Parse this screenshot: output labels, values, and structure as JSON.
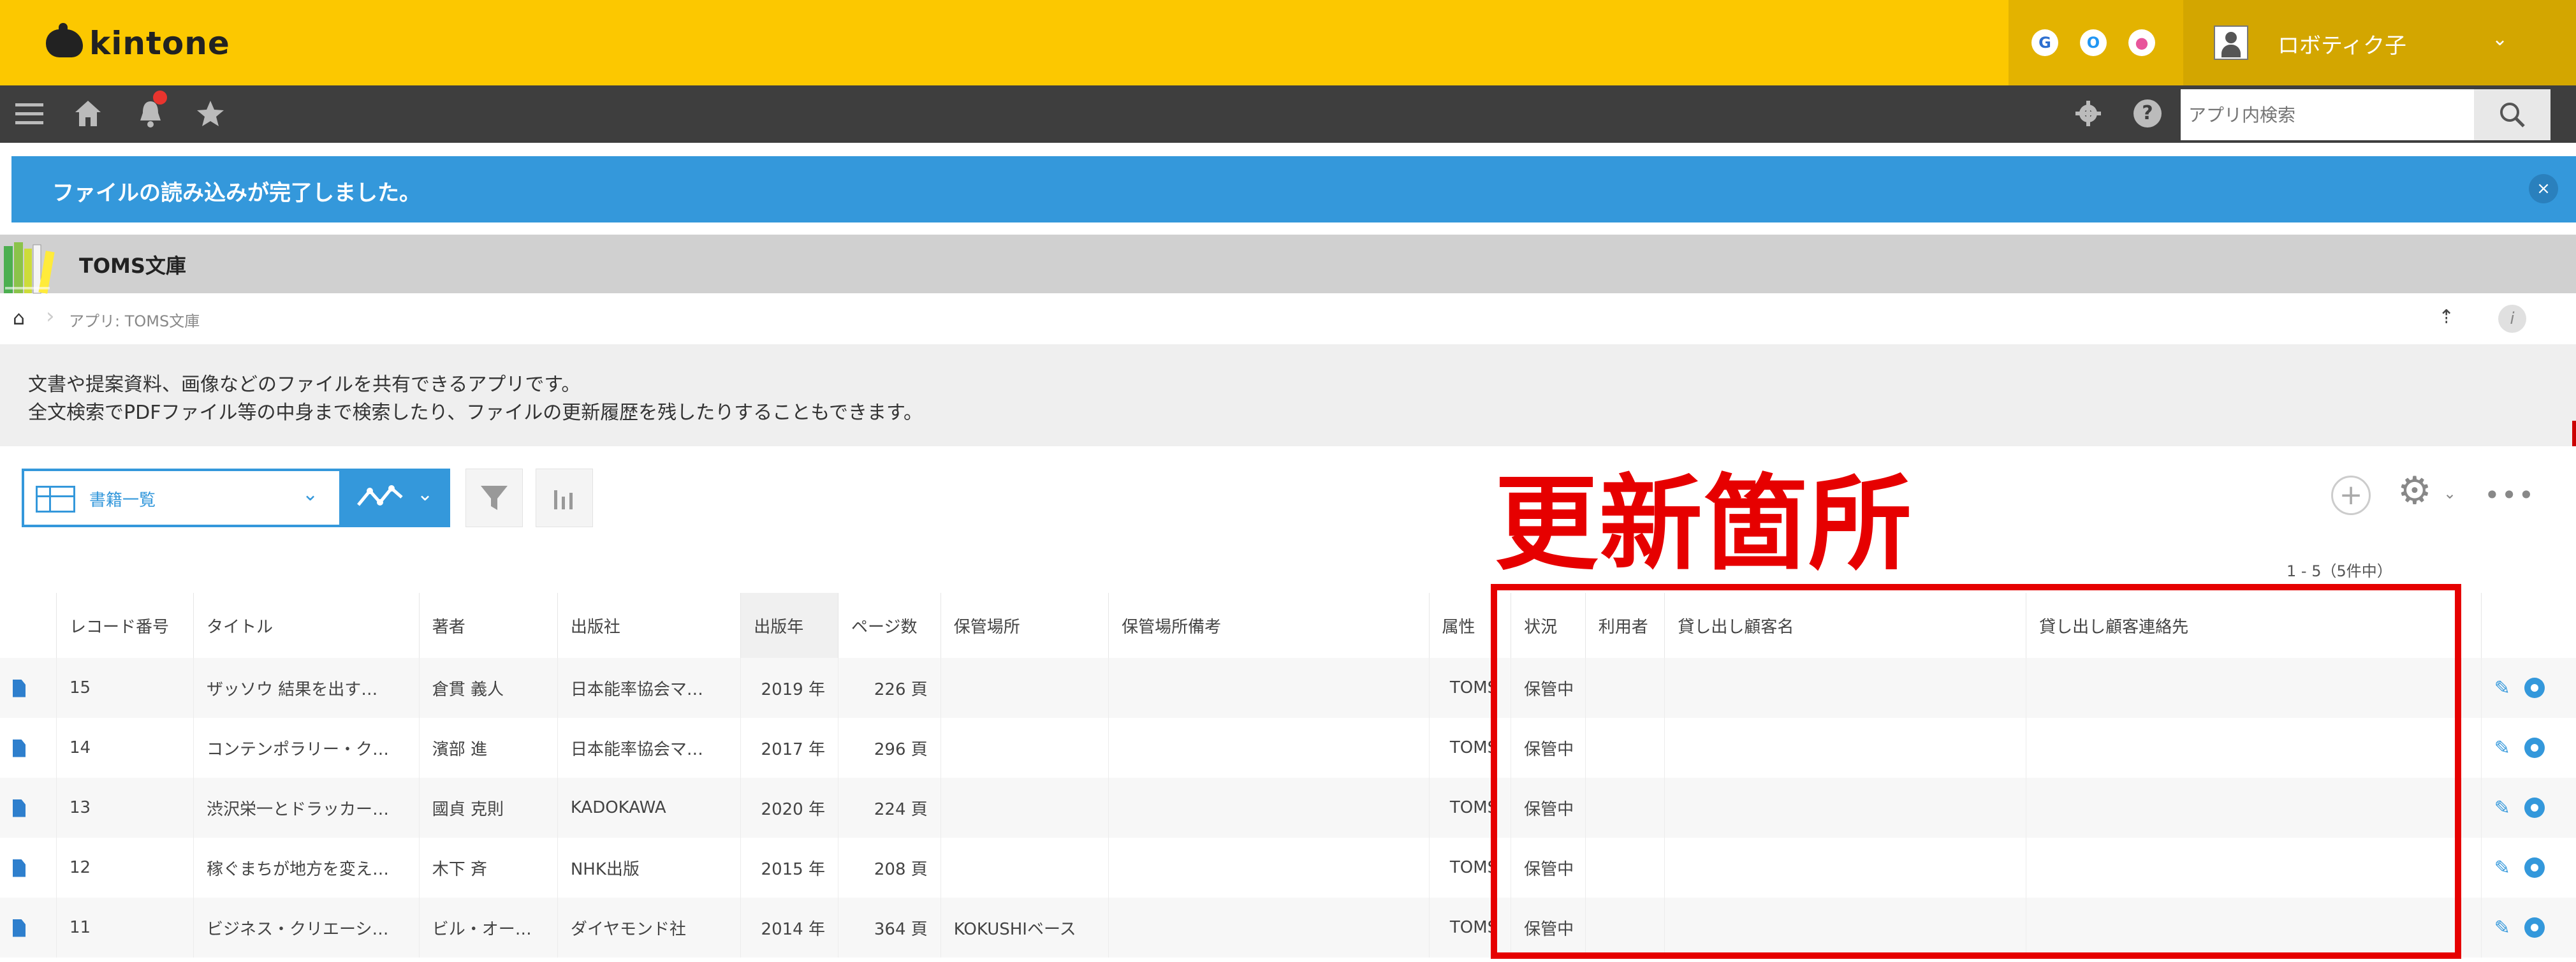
{
  "header": {
    "logo_text": "kintone",
    "apps": [
      {
        "letter": "G",
        "icon": "g-app-icon"
      },
      {
        "letter": "O",
        "icon": "o-app-icon"
      },
      {
        "letter": "●",
        "icon": "mail-app-icon"
      }
    ],
    "user_name": "ロボティク子",
    "user_chevron": "⌄"
  },
  "toolbar": {
    "search_placeholder": "アプリ内検索",
    "icons": [
      "menu-icon",
      "home-icon",
      "bell-icon",
      "star-icon",
      "settings-icon",
      "help-icon",
      "search-icon"
    ]
  },
  "notice": {
    "message": "ファイルの読み込みが完了しました。",
    "close": "×"
  },
  "app": {
    "name": "TOMS文庫",
    "breadcrumb": "アプリ: TOMS文庫",
    "description_line1": "文書や提案資料、画像などのファイルを共有できるアプリです。",
    "description_line2": "全文検索でPDFファイル等の中身まで検索したり、ファイルの更新履歴を残したりすることもできます。"
  },
  "view": {
    "selected": "書籍一覧",
    "count": "1 - 5（5件中）"
  },
  "annotation": {
    "label": "更新箇所",
    "color": "#e60000"
  },
  "table": {
    "columns": [
      "レコード番号",
      "タイトル",
      "著者",
      "出版社",
      "出版年",
      "ページ数",
      "保管場所",
      "保管場所備考",
      "属性",
      "状況",
      "利用者",
      "貸し出し顧客名",
      "貸し出し顧客連絡先"
    ],
    "rows": [
      {
        "id": "15",
        "title": "ザッソウ 結果を出す…",
        "author": "倉貫 義人",
        "publisher": "日本能率協会マ…",
        "year": "2019 年",
        "pages": "226 頁",
        "location": "",
        "location_note": "",
        "attr": "TOMS",
        "status": "保管中",
        "user": "",
        "customer": "",
        "contact": ""
      },
      {
        "id": "14",
        "title": "コンテンポラリー・ク…",
        "author": "濱部 進",
        "publisher": "日本能率協会マ…",
        "year": "2017 年",
        "pages": "296 頁",
        "location": "",
        "location_note": "",
        "attr": "TOMS",
        "status": "保管中",
        "user": "",
        "customer": "",
        "contact": ""
      },
      {
        "id": "13",
        "title": "渋沢栄一とドラッカー…",
        "author": "國貞 克則",
        "publisher": "KADOKAWA",
        "year": "2020 年",
        "pages": "224 頁",
        "location": "",
        "location_note": "",
        "attr": "TOMS",
        "status": "保管中",
        "user": "",
        "customer": "",
        "contact": ""
      },
      {
        "id": "12",
        "title": "稼ぐまちが地方を変え…",
        "author": "木下 斉",
        "publisher": "NHK出版",
        "year": "2015 年",
        "pages": "208 頁",
        "location": "",
        "location_note": "",
        "attr": "TOMS",
        "status": "保管中",
        "user": "",
        "customer": "",
        "contact": ""
      },
      {
        "id": "11",
        "title": "ビジネス・クリエーシ…",
        "author": "ビル・オー…",
        "publisher": "ダイヤモンド社",
        "year": "2014 年",
        "pages": "364 頁",
        "location": "KOKUSHIベース",
        "location_note": "",
        "attr": "TOMS",
        "status": "保管中",
        "user": "",
        "customer": "",
        "contact": ""
      }
    ]
  },
  "colors": {
    "header_yellow": "#fcc800",
    "toolbar_dark": "#3e3e3e",
    "accent_blue": "#3498db"
  }
}
